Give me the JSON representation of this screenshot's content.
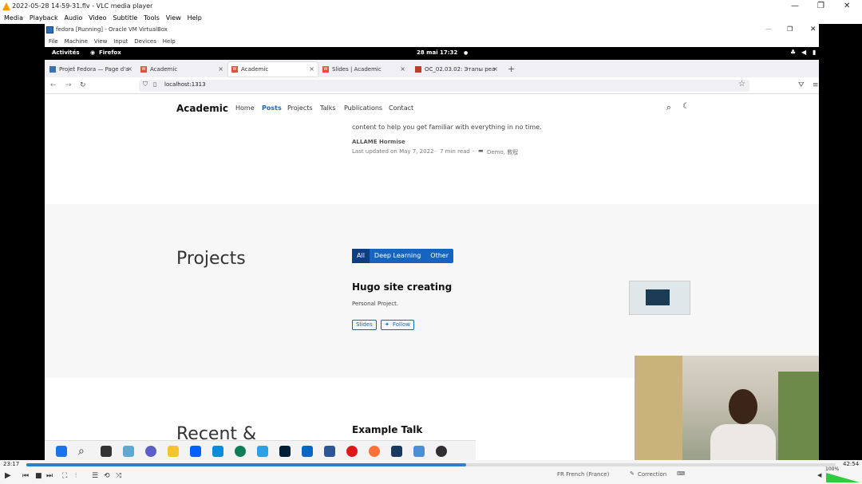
{
  "vlc": {
    "title": "2022-05-28 14-59-31.flv - VLC media player",
    "menu": [
      "Media",
      "Playback",
      "Audio",
      "Video",
      "Subtitle",
      "Tools",
      "View",
      "Help"
    ],
    "time_elapsed": "23:17",
    "time_total": "42:54",
    "progress": 0.543,
    "volume": "100%",
    "status_lang": "FR French (France)",
    "status_correction": "Correction"
  },
  "vbox": {
    "title": "fedora [Running] - Oracle VM VirtualBox",
    "menu": [
      "File",
      "Machine",
      "View",
      "Input",
      "Devices",
      "Help"
    ]
  },
  "gnome": {
    "activities": "Activités",
    "app": "Firefox",
    "clock": "28 mai 17:32"
  },
  "browser": {
    "tabs": [
      {
        "label": "Projet Fedora — Page d'a",
        "active": false
      },
      {
        "label": "Academic",
        "active": false
      },
      {
        "label": "Academic",
        "active": true
      },
      {
        "label": "Slides | Academic",
        "active": false
      },
      {
        "label": "OC_02.03.02: Этапы реа",
        "active": false
      }
    ],
    "url": "localhost:1313"
  },
  "site": {
    "brand": "Academic",
    "nav": [
      "Home",
      "Posts",
      "Projects",
      "Talks",
      "Publications",
      "Contact"
    ],
    "post_snippet": "content to help you get familiar with everything in no time.",
    "post_author": "ALLAME Hormise",
    "post_meta": "Last updated on May 7, 2022",
    "post_read": "7 min read",
    "post_tags": "Demo, 教程",
    "projects_heading": "Projects",
    "filters": [
      "All",
      "Deep Learning",
      "Other"
    ],
    "project_title": "Hugo site creating",
    "project_desc": "Personal Project.",
    "project_btn_slides": "Slides",
    "project_btn_follow": "Follow",
    "recent_heading": "Recent &",
    "talk_title": "Example Talk"
  },
  "colors": {
    "accent": "#1565c0",
    "filter_bg": "#1565c0",
    "vlc_progress": "#2a7fd4"
  }
}
